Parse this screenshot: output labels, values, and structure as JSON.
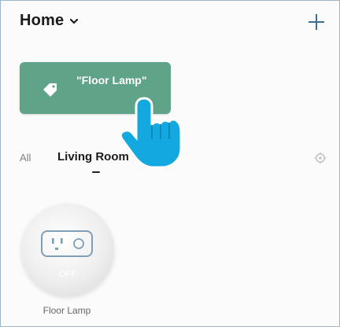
{
  "header": {
    "home_label": "Home",
    "add_icon": "plus-icon"
  },
  "scene": {
    "label": "\"Floor Lamp\"",
    "icon": "tag-icon",
    "color": "#5fa389"
  },
  "tabs": [
    {
      "label": "All",
      "active": false
    },
    {
      "label": "Living Room",
      "active": true
    }
  ],
  "device": {
    "name": "Floor Lamp",
    "state": "OFF",
    "icon": "outlet-icon"
  }
}
